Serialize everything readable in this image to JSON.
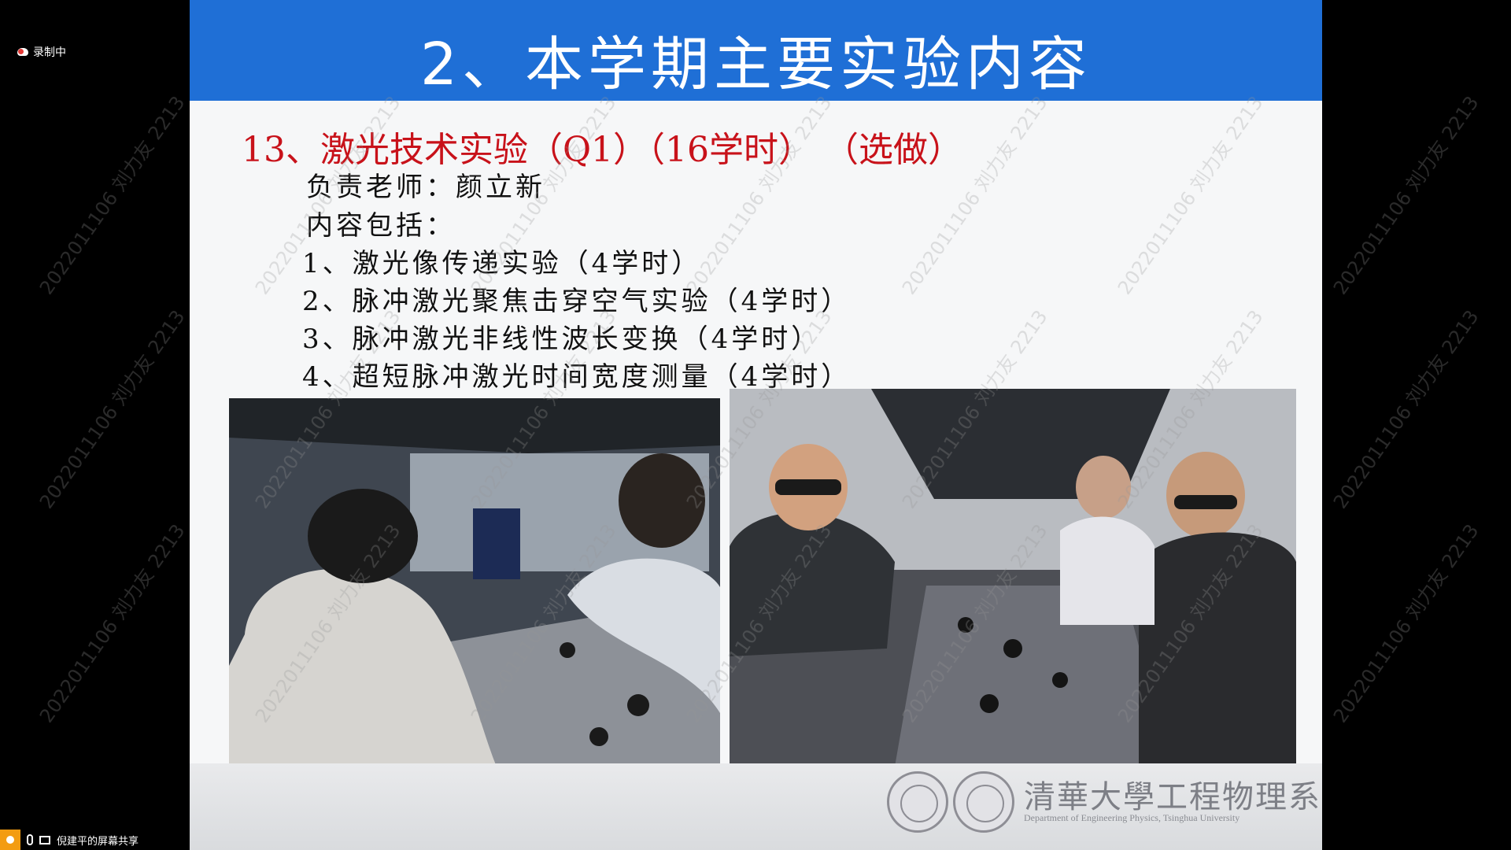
{
  "recording": {
    "label": "录制中"
  },
  "slide": {
    "title": "2、本学期主要实验内容",
    "heading": "13、激光技术实验（Q1）（16学时）  （选做）",
    "lines": [
      "负责老师：颜立新",
      "内容包括：",
      "1、激光像传递实验（4学时）",
      "2、脉冲激光聚焦击穿空气实验（4学时）",
      "3、脉冲激光非线性波长变换（4学时）",
      "4、超短脉冲激光时间宽度测量（4学时）"
    ],
    "footer": {
      "university": "清華大學工程物理系",
      "department_en": "Department of Engineering Physics, Tsinghua University"
    }
  },
  "watermark": {
    "text": "2022011106 刘力友 2213"
  },
  "share_bar": {
    "label": "倪建平的屏幕共享"
  },
  "colors": {
    "header_blue": "#1f6fd6",
    "heading_red": "#c8121a",
    "recording_dot": "#e53935"
  }
}
